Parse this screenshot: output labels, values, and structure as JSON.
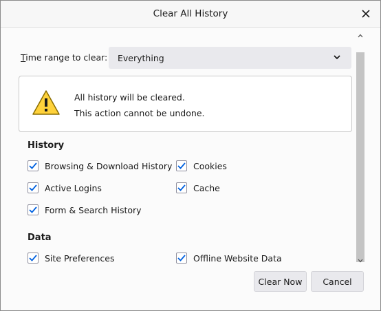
{
  "dialog": {
    "title": "Clear All History",
    "close_icon": "close-icon"
  },
  "time_range": {
    "label_prefix": "",
    "label_accesskey": "T",
    "label_rest": "ime range to clear:",
    "selected": "Everything",
    "chevron_icon": "chevron-down-icon"
  },
  "warning": {
    "icon": "warning-icon",
    "line1": "All history will be cleared.",
    "line2": "This action cannot be undone."
  },
  "history": {
    "title": "History",
    "items": [
      {
        "label": "Browsing & Download History",
        "checked": true
      },
      {
        "label": "Cookies",
        "checked": true
      },
      {
        "label": "Active Logins",
        "checked": true
      },
      {
        "label": "Cache",
        "checked": true
      },
      {
        "label": "Form & Search History",
        "checked": true
      }
    ]
  },
  "data": {
    "title": "Data",
    "items": [
      {
        "label": "Site Preferences",
        "checked": true
      },
      {
        "label": "Offline Website Data",
        "checked": true
      }
    ]
  },
  "buttons": {
    "clear_now": "Clear Now",
    "cancel": "Cancel"
  },
  "colors": {
    "check": "#0061e0",
    "warning_fill": "#ffd23b",
    "warning_stroke": "#8a6d00"
  }
}
